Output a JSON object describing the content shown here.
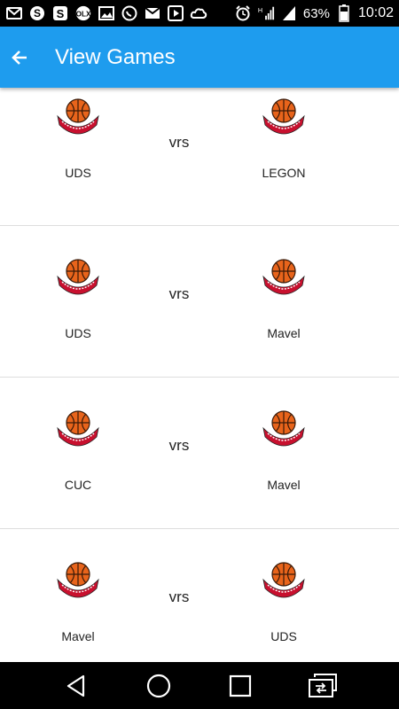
{
  "status_bar": {
    "battery_percent": "63%",
    "time": "10:02",
    "icons": [
      "mail-icon",
      "skype-icon",
      "s-app-icon",
      "olx-icon",
      "image-icon",
      "whatsapp-icon",
      "gmail-icon",
      "play-icon",
      "cloud-icon",
      "alarm-icon",
      "signal-h-icon",
      "signal-icon",
      "battery-icon"
    ]
  },
  "app_bar": {
    "title": "View Games",
    "back_icon": "arrow-left-icon",
    "color": "#1e9cee"
  },
  "vs_label": "vrs",
  "games": [
    {
      "home": "UDS",
      "away": "LEGON"
    },
    {
      "home": "UDS",
      "away": "Mavel"
    },
    {
      "home": "CUC",
      "away": "Mavel"
    },
    {
      "home": "Mavel",
      "away": "UDS"
    }
  ],
  "logo": {
    "text": "BASKETBALL",
    "ball_color": "#e8641b",
    "banner_color": "#c8102e"
  },
  "nav_bar": {
    "icons": [
      "back-triangle-icon",
      "home-circle-icon",
      "recents-square-icon",
      "screen-switch-icon"
    ]
  }
}
